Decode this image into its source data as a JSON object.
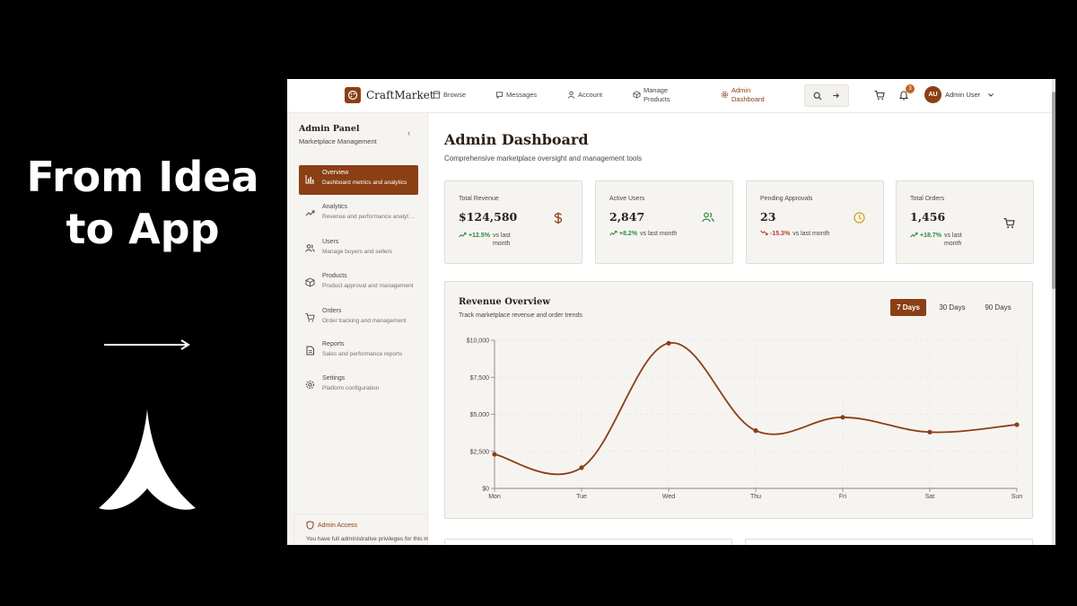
{
  "promo": {
    "title_line1": "From Idea",
    "title_line2": "to App"
  },
  "app": {
    "brand": "CraftMarket",
    "nav": [
      {
        "label": "Browse",
        "icon": "store-icon"
      },
      {
        "label": "Messages",
        "icon": "chat-icon"
      },
      {
        "label": "Account",
        "icon": "user-icon"
      },
      {
        "label_line1": "Manage",
        "label_line2": "Products",
        "icon": "box-icon"
      },
      {
        "label_line1": "Admin",
        "label_line2": "Dashboard",
        "icon": "gear-icon"
      }
    ],
    "notification_count": "3",
    "user": {
      "initials": "AU",
      "name": "Admin User"
    }
  },
  "sidebar": {
    "title": "Admin Panel",
    "subtitle": "Marketplace Management",
    "items": [
      {
        "label": "Overview",
        "desc": "Dashboard metrics and analytics",
        "icon": "bar-chart-icon",
        "active": true
      },
      {
        "label": "Analytics",
        "desc": "Revenue and performance analytics",
        "icon": "trending-icon"
      },
      {
        "label": "Users",
        "desc": "Manage buyers and sellers",
        "icon": "users-icon"
      },
      {
        "label": "Products",
        "desc": "Product approval and management",
        "icon": "package-icon"
      },
      {
        "label": "Orders",
        "desc": "Order tracking and management",
        "icon": "cart-icon"
      },
      {
        "label": "Reports",
        "desc": "Sales and performance reports",
        "icon": "document-icon"
      },
      {
        "label": "Settings",
        "desc": "Platform configuration",
        "icon": "gear-icon"
      }
    ],
    "access_title": "Admin Access",
    "access_text": "You have full administrative privileges for this marketplace."
  },
  "main": {
    "title": "Admin Dashboard",
    "subtitle": "Comprehensive marketplace oversight and management tools",
    "stats": [
      {
        "label": "Total Revenue",
        "value": "$124,580",
        "change": "+12.5%",
        "vs": "vs last month",
        "trend": "up",
        "icon": "dollar-icon",
        "icon_color": "#8b3f14"
      },
      {
        "label": "Active Users",
        "value": "2,847",
        "change": "+8.2%",
        "vs": "vs last month",
        "trend": "up",
        "icon": "users-icon",
        "icon_color": "#2f8a3e"
      },
      {
        "label": "Pending Approvals",
        "value": "23",
        "change": "-15.3%",
        "vs": "vs last month",
        "trend": "down",
        "icon": "clock-icon",
        "icon_color": "#d4a017"
      },
      {
        "label": "Total Orders",
        "value": "1,456",
        "change": "+18.7%",
        "vs": "vs last month",
        "trend": "up",
        "icon": "cart-icon",
        "icon_color": "#3d3530"
      }
    ],
    "chart_card": {
      "title": "Revenue Overview",
      "subtitle": "Track marketplace revenue and order trends",
      "ranges": [
        "7 Days",
        "30 Days",
        "90 Days"
      ],
      "active_range": "7 Days"
    }
  },
  "colors": {
    "accent": "#8b3f14",
    "card_bg": "#f6f4f1",
    "up": "#2f8a3e",
    "down": "#c0392b"
  },
  "chart_data": {
    "type": "line",
    "categories": [
      "Mon",
      "Tue",
      "Wed",
      "Thu",
      "Fri",
      "Sat",
      "Sun"
    ],
    "series": [
      {
        "values": [
          2300,
          1400,
          9800,
          3900,
          4800,
          3800,
          4300
        ]
      }
    ],
    "y_ticks": [
      "$0",
      "$2,500",
      "$5,000",
      "$7,500",
      "$10,000"
    ],
    "ylim": [
      0,
      10000
    ],
    "grid": true,
    "line_color": "#8b3f14"
  }
}
